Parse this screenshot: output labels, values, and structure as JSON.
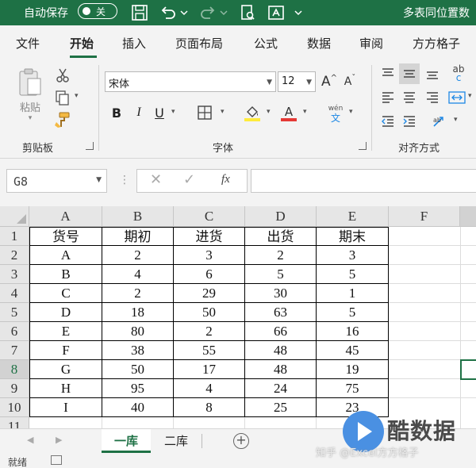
{
  "titlebar": {
    "autosave_label": "自动保存",
    "toggle_state": "关",
    "doc_title": "多表同位置数"
  },
  "tabs": [
    "文件",
    "开始",
    "插入",
    "页面布局",
    "公式",
    "数据",
    "审阅",
    "方方格子"
  ],
  "ribbon": {
    "paste_label": "粘贴",
    "clipboard_group": "剪贴板",
    "font_name": "宋体",
    "font_size": "12",
    "font_group": "字体",
    "bold": "B",
    "italic": "I",
    "underline": "U",
    "phonetic_top": "wén",
    "phonetic_bottom": "文",
    "align_group": "对齐方式",
    "grow_font": "A",
    "shrink_font": "A",
    "font_color_letter": "A",
    "wrap_label": "ab",
    "wrap_sub": "c",
    "colors": {
      "highlight": "#ffeb3b",
      "font_color": "#e53935",
      "accent": "#1e7145"
    }
  },
  "formula_bar": {
    "name_box": "G8",
    "fx": "fx",
    "formula": ""
  },
  "columns": [
    "A",
    "B",
    "C",
    "D",
    "E",
    "F"
  ],
  "rows": [
    "1",
    "2",
    "3",
    "4",
    "5",
    "6",
    "7",
    "8",
    "9",
    "10",
    "11"
  ],
  "table": {
    "header": [
      "货号",
      "期初",
      "进货",
      "出货",
      "期末"
    ],
    "data": [
      [
        "A",
        "2",
        "3",
        "2",
        "3"
      ],
      [
        "B",
        "4",
        "6",
        "5",
        "5"
      ],
      [
        "C",
        "2",
        "29",
        "30",
        "1"
      ],
      [
        "D",
        "18",
        "50",
        "63",
        "5"
      ],
      [
        "E",
        "80",
        "2",
        "66",
        "16"
      ],
      [
        "F",
        "38",
        "55",
        "48",
        "45"
      ],
      [
        "G",
        "50",
        "17",
        "48",
        "19"
      ],
      [
        "H",
        "95",
        "4",
        "24",
        "75"
      ],
      [
        "I",
        "40",
        "8",
        "25",
        "23"
      ]
    ]
  },
  "sheets": [
    "一库",
    "二库"
  ],
  "add_sheet": "+",
  "status": "就绪",
  "watermark": {
    "brand": "酷数据",
    "sub": "知乎 @Excel方方格子"
  }
}
